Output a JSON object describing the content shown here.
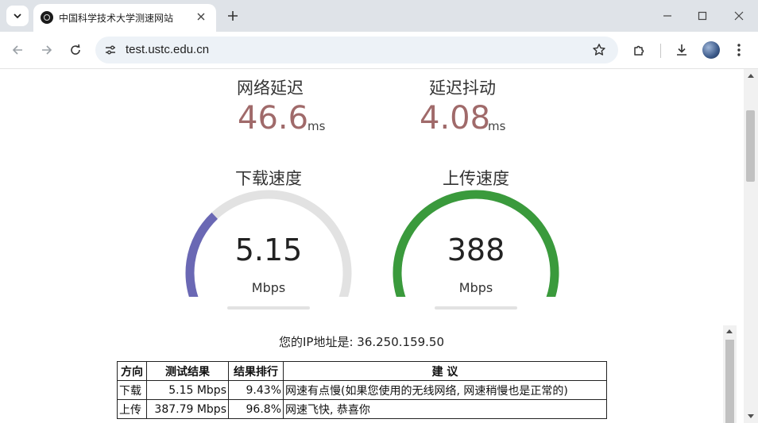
{
  "browser": {
    "tab_title": "中国科学技术大学测速网站",
    "url": "test.ustc.edu.cn"
  },
  "metrics": {
    "latency": {
      "label": "网络延迟",
      "value": "46.6",
      "unit": "ms"
    },
    "jitter": {
      "label": "延迟抖动",
      "value": "4.08",
      "unit": "ms"
    }
  },
  "gauges": {
    "download": {
      "title": "下载速度",
      "value": "5.15",
      "unit": "Mbps",
      "fill_fraction": 0.32,
      "color": "#6a68b4"
    },
    "upload": {
      "title": "上传速度",
      "value": "388",
      "unit": "Mbps",
      "fill_fraction": 1.0,
      "color": "#3a9a3c"
    }
  },
  "ip_line": "您的IP地址是: 36.250.159.50",
  "results_table": {
    "headers": [
      "方向",
      "测试结果",
      "结果排行",
      "建 议"
    ],
    "rows": [
      [
        "下载",
        "5.15 Mbps",
        "9.43%",
        "网速有点慢(如果您使用的无线网络, 网速稍慢也是正常的)"
      ],
      [
        "上传",
        "387.79 Mbps",
        "96.8%",
        "网速飞快, 恭喜你"
      ]
    ]
  },
  "colors": {
    "metric_value": "#a06a6a",
    "gauge_track": "#e2e2e2"
  }
}
